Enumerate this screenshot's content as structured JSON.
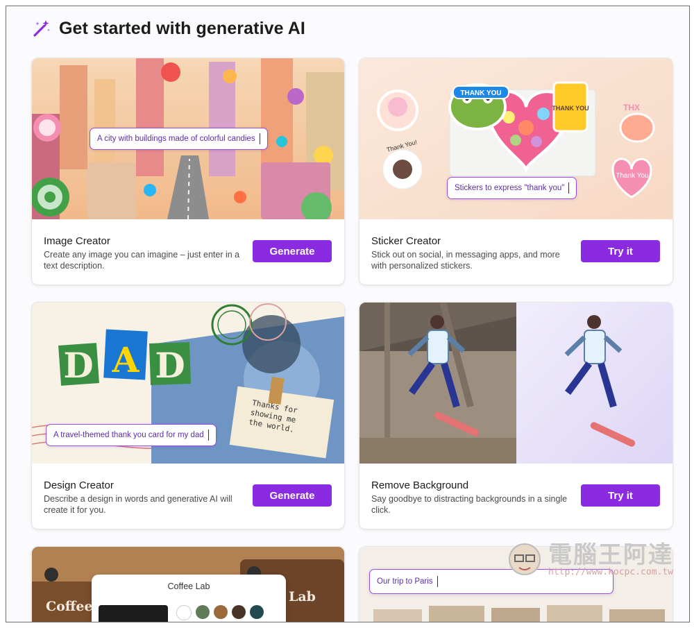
{
  "header": {
    "title": "Get started with generative AI",
    "icon": "magic-wand-icon"
  },
  "accent": "#8a2be2",
  "cards": [
    {
      "title": "Image Creator",
      "description": "Create any image you can imagine – just enter in a text description.",
      "button": "Generate",
      "prompt": "A city with buildings made of colorful candies"
    },
    {
      "title": "Sticker Creator",
      "description": "Stick out on social, in messaging apps, and more with personalized stickers.",
      "button": "Try it",
      "prompt": "Stickers to express \"thank you\"",
      "sticker_texts": [
        "THANK YOU",
        "THANK YOU",
        "Thank You!",
        "THX",
        "Thank You"
      ]
    },
    {
      "title": "Design Creator",
      "description": "Describe a design in words and generative AI will create it for you.",
      "button": "Generate",
      "prompt": "A travel-themed thank you card for my dad",
      "design_letters": [
        "D",
        "A",
        "D"
      ],
      "note_text": "Thanks for showing me the world."
    },
    {
      "title": "Remove Background",
      "description": "Say goodbye to distracting backgrounds in a single click.",
      "button": "Try it"
    },
    {
      "title": "Coffee Lab",
      "prompt": "",
      "coffee_label": "Coffee Lab",
      "coffee_sign": "Coffee Lab",
      "coffee_sign_right": "Lab"
    },
    {
      "title": "",
      "prompt": "Our trip to Paris"
    }
  ],
  "watermark": {
    "text": "電腦王阿達",
    "url": "http://www.kocpc.com.tw"
  }
}
